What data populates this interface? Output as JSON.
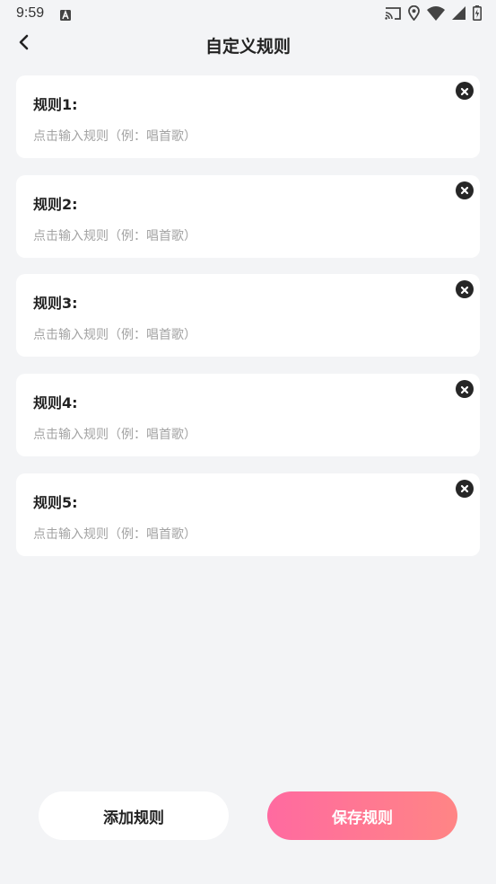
{
  "status_bar": {
    "time": "9:59"
  },
  "header": {
    "title": "自定义规则"
  },
  "rules": [
    {
      "label": "规则1:",
      "value": "",
      "placeholder": "点击输入规则（例：唱首歌）"
    },
    {
      "label": "规则2:",
      "value": "",
      "placeholder": "点击输入规则（例：唱首歌）"
    },
    {
      "label": "规则3:",
      "value": "",
      "placeholder": "点击输入规则（例：唱首歌）"
    },
    {
      "label": "规则4:",
      "value": "",
      "placeholder": "点击输入规则（例：唱首歌）"
    },
    {
      "label": "规则5:",
      "value": "",
      "placeholder": "点击输入规则（例：唱首歌）"
    }
  ],
  "actions": {
    "add_label": "添加规则",
    "save_label": "保存规则"
  },
  "colors": {
    "background": "#f3f4f6",
    "card": "#ffffff",
    "placeholder": "#a3a3a3",
    "save_gradient_start": "#ff6aa0",
    "save_gradient_end": "#ff8585",
    "delete_icon": "#262626"
  },
  "icons": {
    "status": [
      "a-notification-icon",
      "cast-icon",
      "location-icon",
      "wifi-icon",
      "signal-icon",
      "battery-icon"
    ],
    "back": "chevron-left-icon",
    "delete": "close-circle-icon"
  }
}
